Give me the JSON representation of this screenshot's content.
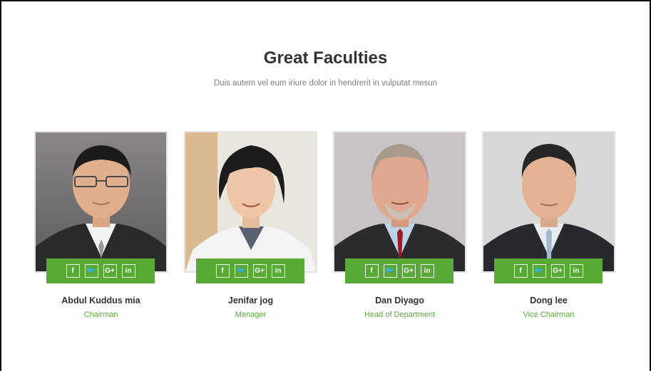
{
  "section": {
    "title": "Great Faculties",
    "subtitle": "Duis autem vel eum iriure dolor in hendrerit in vulputat mesun"
  },
  "social_icons": [
    {
      "icon": "facebook-icon",
      "glyph": "f"
    },
    {
      "icon": "twitter-icon",
      "glyph": "🐦"
    },
    {
      "icon": "google-plus-icon",
      "glyph": "G+"
    },
    {
      "icon": "linkedin-icon",
      "glyph": "in"
    }
  ],
  "faculty": [
    {
      "name": "Abdul Kuddus mia",
      "role": "Chairman"
    },
    {
      "name": "Jenifar jog",
      "role": "Menager"
    },
    {
      "name": "Dan Diyago",
      "role": "Head of Department"
    },
    {
      "name": "Dong lee",
      "role": "Vice Chairman"
    }
  ],
  "colors": {
    "accent": "#58a935",
    "heading": "#333333",
    "muted": "#7d7d7d"
  }
}
